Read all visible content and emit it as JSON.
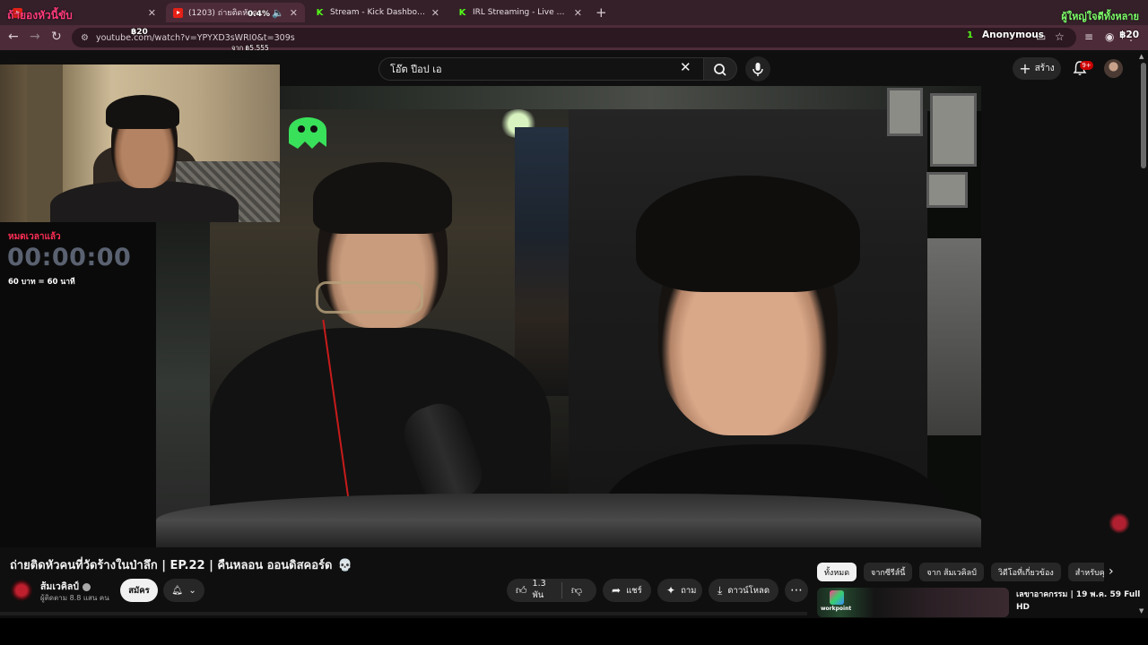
{
  "browser": {
    "tabs": [
      {
        "title": "",
        "favicon": "youtube-icon",
        "active": false
      },
      {
        "title": "(1203) ถ่ายติดหัวคนที่วัดร้างในป่าลึก",
        "favicon": "youtube-icon",
        "active": true
      },
      {
        "title": "Stream - Kick Dashboard",
        "favicon": "kick-icon",
        "active": false
      },
      {
        "title": "IRL Streaming - Live Streams on",
        "favicon": "kick-icon",
        "active": false
      }
    ],
    "url": "youtube.com/watch?v=YPYXD3sWRI0&t=309s"
  },
  "stream_overlay": {
    "top_left_title": "ถ้ายองหัวนี้ขับ",
    "top_right_text": "ผู้ใหญ่ใจดีทั้งหลาย",
    "progress_text": "0.4%",
    "amount_left": "฿20",
    "from_text": "จาก ฿5,555",
    "donor_count": "1",
    "donor_name": "Anonymous",
    "donor_amount": "฿20",
    "timer_label": "หมดเวลาแล้ว",
    "timer_value": "00:00:00",
    "timer_rate": "60 บาท = 60 นาที"
  },
  "youtube": {
    "search_query": "โอ๊ต ปีอป เอ",
    "create_label": "สร้าง",
    "notification_count": "9+",
    "video_title": "ถ่ายติดหัวคนที่วัดร้างในป่าลึก | EP.22 | คืนหลอน ออนดิสคอร์ด",
    "title_emoji": "💀",
    "channel_name": "ส้มเวคิลป์",
    "subscribers": "ผู้ติดตาม 8.8 แสน คน",
    "subscribe_label": "สมัคร",
    "likes": "1.3 พัน",
    "share_label": "แชร์",
    "ask_label": "ถาม",
    "download_label": "ดาวน์โหลด",
    "chips": [
      "ทั้งหมด",
      "จากซีรีส์นี้",
      "จาก ส้มเวคิลป์",
      "วิดีโอที่เกี่ยวข้อง",
      "สำหรับคุณ"
    ],
    "recommendation": {
      "channel_logo": "workpoint",
      "title": "เลขาอาคกรรม | 19 พ.ค. 59 Full HD"
    }
  },
  "colors": {
    "overlay_pink": "#ff2d55",
    "overlay_green": "#7dff6a",
    "kick_green": "#53fc18",
    "youtube_red": "#cc0000"
  }
}
